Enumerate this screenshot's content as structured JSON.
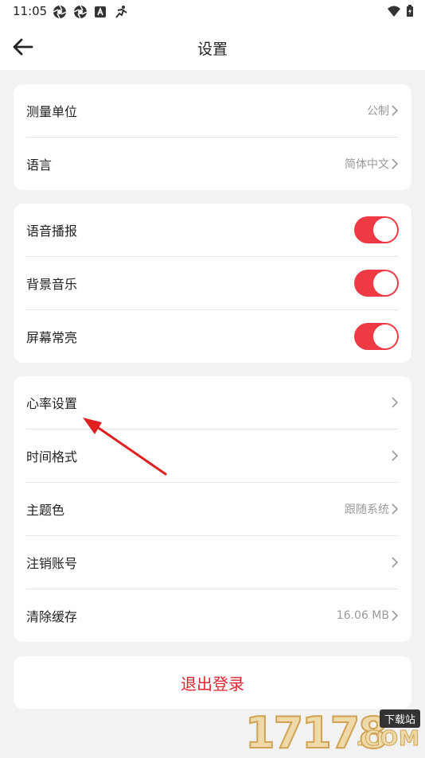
{
  "status_bar": {
    "time": "11:05",
    "icons": [
      "aperture-icon",
      "aperture-icon",
      "a-icon",
      "running-icon"
    ],
    "right_icons": [
      "wifi-icon",
      "battery-icon"
    ]
  },
  "header": {
    "title": "设置",
    "back_icon": "arrow-left-icon"
  },
  "group1": [
    {
      "label": "测量单位",
      "value": "公制"
    },
    {
      "label": "语言",
      "value": "简体中文"
    }
  ],
  "group2": [
    {
      "label": "语音播报",
      "on": true
    },
    {
      "label": "背景音乐",
      "on": true
    },
    {
      "label": "屏幕常亮",
      "on": true
    }
  ],
  "group3": [
    {
      "label": "心率设置",
      "value": ""
    },
    {
      "label": "时间格式",
      "value": ""
    },
    {
      "label": "主题色",
      "value": "跟随系统"
    },
    {
      "label": "注销账号",
      "value": ""
    },
    {
      "label": "清除缓存",
      "value": "16.06 MB"
    }
  ],
  "logout": {
    "label": "退出登录"
  },
  "colors": {
    "accent": "#ee3a45",
    "logout_text": "#e0242f",
    "background": "#f2f2f2"
  },
  "watermark": {
    "digits": "17178",
    "tag": "下载站",
    "com": ".COM"
  }
}
